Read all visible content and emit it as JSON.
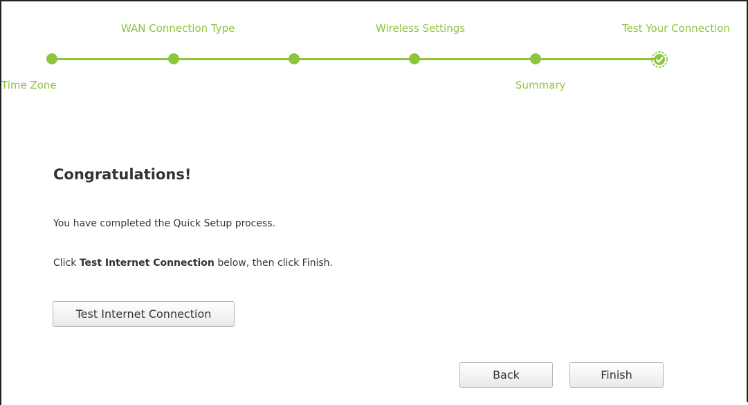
{
  "steps": {
    "time_zone": "Time Zone",
    "wan_connection_type": "WAN Connection Type",
    "wireless_settings": "Wireless Settings",
    "summary": "Summary",
    "test_your_connection": "Test Your Connection"
  },
  "content": {
    "title": "Congratulations!",
    "line1": "You have completed the Quick Setup process.",
    "line2_prefix": "Click ",
    "line2_bold": "Test Internet Connection",
    "line2_suffix": " below, then click Finish."
  },
  "buttons": {
    "test": "Test Internet Connection",
    "back": "Back",
    "finish": "Finish"
  },
  "colors": {
    "accent": "#8cc63f"
  }
}
